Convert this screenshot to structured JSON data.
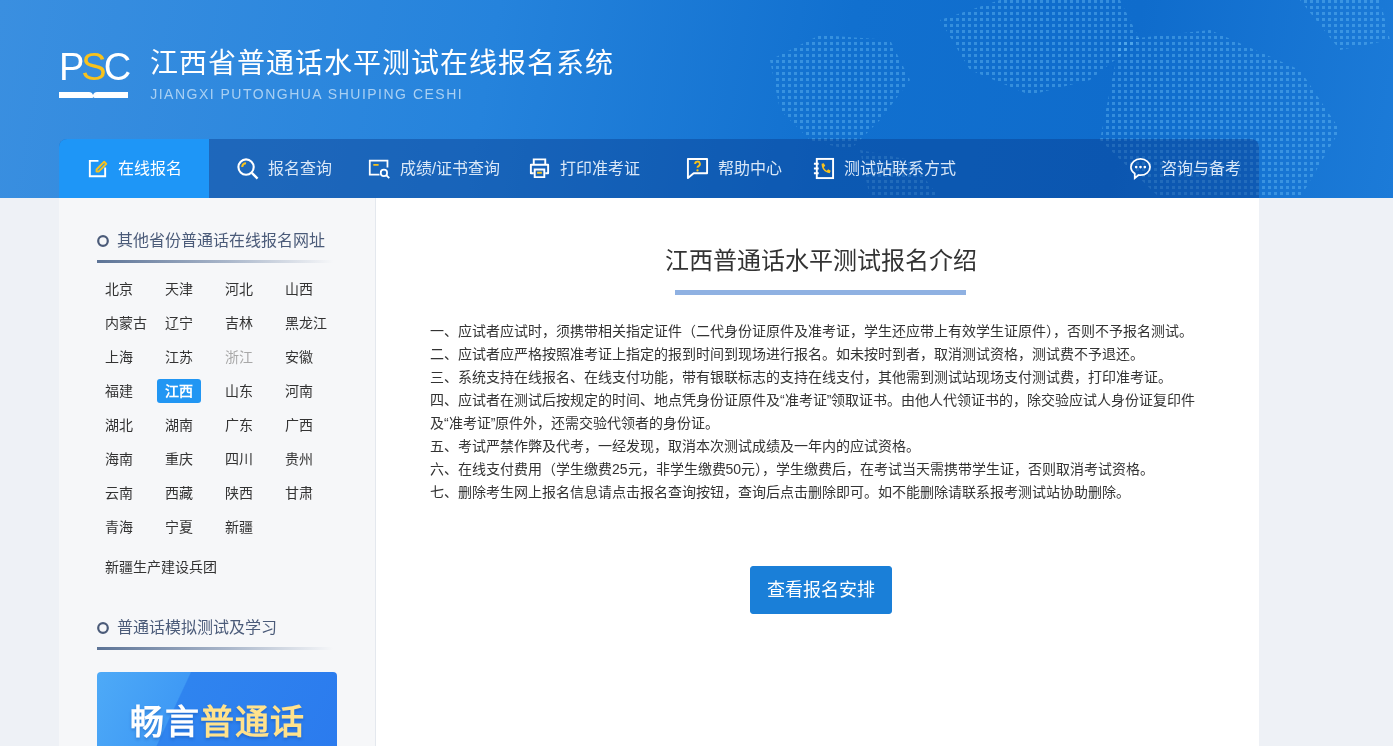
{
  "header": {
    "logo": {
      "before": "P",
      "highlight": "S",
      "after": "C"
    },
    "title": "江西省普通话水平测试在线报名系统",
    "subtitle": "JIANGXI PUTONGHUA SHUIPING CESHI"
  },
  "nav": {
    "items": [
      {
        "label": "在线报名",
        "selected": true
      },
      {
        "label": "报名查询",
        "selected": false
      },
      {
        "label": "成绩/证书查询",
        "selected": false
      },
      {
        "label": "打印准考证",
        "selected": false
      },
      {
        "label": "帮助中心",
        "selected": false
      },
      {
        "label": "测试站联系方式",
        "selected": false
      }
    ],
    "aside": {
      "label": "咨询与备考",
      "selected": false
    }
  },
  "sidebar": {
    "province_heading": "其他省份普通话在线报名网址",
    "provinces": [
      {
        "name": "北京",
        "selected": false,
        "disabled": false
      },
      {
        "name": "天津",
        "selected": false,
        "disabled": false
      },
      {
        "name": "河北",
        "selected": false,
        "disabled": false
      },
      {
        "name": "山西",
        "selected": false,
        "disabled": false
      },
      {
        "name": "内蒙古",
        "selected": false,
        "disabled": false
      },
      {
        "name": "辽宁",
        "selected": false,
        "disabled": false
      },
      {
        "name": "吉林",
        "selected": false,
        "disabled": false
      },
      {
        "name": "黑龙江",
        "selected": false,
        "disabled": false
      },
      {
        "name": "上海",
        "selected": false,
        "disabled": false
      },
      {
        "name": "江苏",
        "selected": false,
        "disabled": false
      },
      {
        "name": "浙江",
        "selected": false,
        "disabled": true
      },
      {
        "name": "安徽",
        "selected": false,
        "disabled": false
      },
      {
        "name": "福建",
        "selected": false,
        "disabled": false
      },
      {
        "name": "江西",
        "selected": true,
        "disabled": false
      },
      {
        "name": "山东",
        "selected": false,
        "disabled": false
      },
      {
        "name": "河南",
        "selected": false,
        "disabled": false
      },
      {
        "name": "湖北",
        "selected": false,
        "disabled": false
      },
      {
        "name": "湖南",
        "selected": false,
        "disabled": false
      },
      {
        "name": "广东",
        "selected": false,
        "disabled": false
      },
      {
        "name": "广西",
        "selected": false,
        "disabled": false
      },
      {
        "name": "海南",
        "selected": false,
        "disabled": false
      },
      {
        "name": "重庆",
        "selected": false,
        "disabled": false
      },
      {
        "name": "四川",
        "selected": false,
        "disabled": false
      },
      {
        "name": "贵州",
        "selected": false,
        "disabled": false
      },
      {
        "name": "云南",
        "selected": false,
        "disabled": false
      },
      {
        "name": "西藏",
        "selected": false,
        "disabled": false
      },
      {
        "name": "陕西",
        "selected": false,
        "disabled": false
      },
      {
        "name": "甘肃",
        "selected": false,
        "disabled": false
      },
      {
        "name": "青海",
        "selected": false,
        "disabled": false
      },
      {
        "name": "宁夏",
        "selected": false,
        "disabled": false
      },
      {
        "name": "新疆",
        "selected": false,
        "disabled": false
      }
    ],
    "corps_link": {
      "name": "新疆生产建设兵团",
      "selected": false,
      "disabled": false
    },
    "study_heading": "普通话模拟测试及学习",
    "promo": {
      "title": "畅言",
      "highlight": "普通话"
    }
  },
  "main": {
    "title": "江西普通话水平测试报名介绍",
    "rules": [
      "一、应试者应试时，须携带相关指定证件（二代身份证原件及准考证，学生还应带上有效学生证原件），否则不予报名测试。",
      "二、应试者应严格按照准考证上指定的报到时间到现场进行报名。如未按时到者，取消测试资格，测试费不予退还。",
      "三、系统支持在线报名、在线支付功能，带有银联标志的支持在线支付，其他需到测试站现场支付测试费，打印准考证。",
      "四、应试者在测试后按规定的时间、地点凭身份证原件及“准考证”领取证书。由他人代领证书的，除交验应试人身份证复印件及“准考证”原件外，还需交验代领者的身份证。",
      "五、考试严禁作弊及代考，一经发现，取消本次测试成绩及一年内的应试资格。",
      "六、在线支付费用（学生缴费25元，非学生缴费50元），学生缴费后，在考试当天需携带学生证，否则取消考试资格。",
      "七、删除考生网上报名信息请点击报名查询按钮，查询后点击删除即可。如不能删除请联系报考测试站协助删除。"
    ],
    "button": "查看报名安排"
  }
}
